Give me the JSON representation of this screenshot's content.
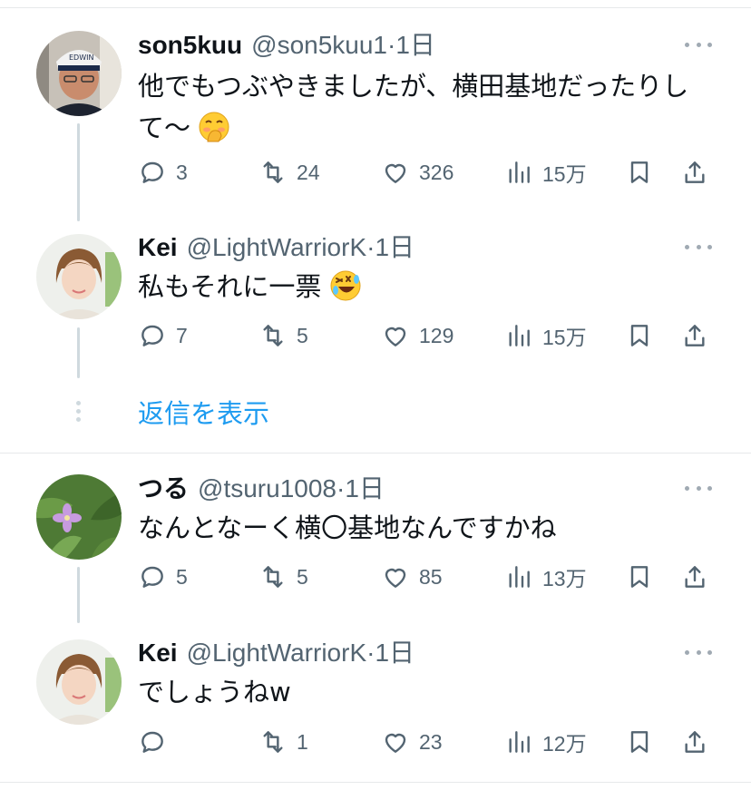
{
  "tweets": [
    {
      "name": "son5kuu",
      "handle": "@son5kuu1",
      "time": "1日",
      "text_line1": "他でもつぶやきましたが、横田基地だったりし",
      "text_line2": "て〜",
      "emoji": "face-with-hand-over-mouth",
      "replies": "3",
      "retweets": "24",
      "likes": "326",
      "views": "15万"
    },
    {
      "name": "Kei",
      "handle": "@LightWarriorK",
      "time": "1日",
      "text": "私もそれに一票",
      "emoji": "rolling-on-floor-laughing",
      "replies": "7",
      "retweets": "5",
      "likes": "129",
      "views": "15万"
    },
    {
      "name": "つる",
      "handle": "@tsuru1008",
      "time": "1日",
      "text": "なんとなーく横〇基地なんですかね",
      "replies": "5",
      "retweets": "5",
      "likes": "85",
      "views": "13万"
    },
    {
      "name": "Kei",
      "handle": "@LightWarriorK",
      "time": "1日",
      "text": "でしょうねw",
      "replies": "",
      "retweets": "1",
      "likes": "23",
      "views": "12万"
    }
  ],
  "show_replies_label": "返信を表示",
  "colors": {
    "link": "#1d9bf0",
    "secondary": "#536471",
    "thread_line": "#cfd9de",
    "divider": "#e7e9ea"
  },
  "icons": [
    "reply-icon",
    "retweet-icon",
    "like-icon",
    "views-icon",
    "bookmark-icon",
    "share-icon",
    "more-icon"
  ]
}
